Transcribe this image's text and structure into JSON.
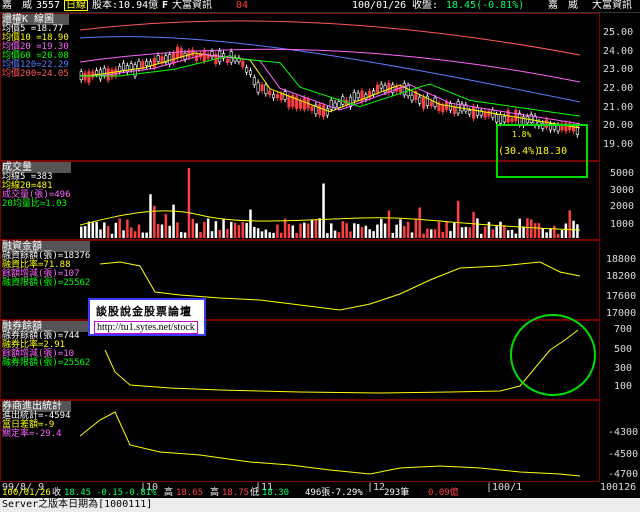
{
  "header": {
    "stock_name": "嘉　威",
    "code": "3557",
    "period": "日線",
    "capital": "股本:10.94億",
    "f_mark": "F",
    "data_source": "大富資訊",
    "counter": "04",
    "date": "100/01/26",
    "close_label": "收盤:",
    "close_value": "18.45(-0.81%)",
    "right_name": "嘉　威",
    "right_source": "大富資訊"
  },
  "price_panel": {
    "title": "還權K 線圖",
    "legend": [
      {
        "label": "均價5 =18.77",
        "color": "#ffffff"
      },
      {
        "label": "均價10 =18.90",
        "color": "#ffff00"
      },
      {
        "label": "均價20 =19.30",
        "color": "#ff66ff"
      },
      {
        "label": "均價60 =20.08",
        "color": "#00ff00"
      },
      {
        "label": "均價120=22.29",
        "color": "#5a7dff"
      },
      {
        "label": "均價200=24.05",
        "color": "#ff5a5a"
      }
    ],
    "ticks": [
      "25.00",
      "24.00",
      "23.00",
      "22.00",
      "21.00",
      "20.00",
      "19.00"
    ],
    "annotation_pct": "(30.4%)",
    "annotation_price": "18.30",
    "annotation_mid": "1.8%"
  },
  "volume_panel": {
    "title": "成交量",
    "legend": [
      {
        "label": "均線5 =383",
        "color": "#ffffff"
      },
      {
        "label": "均線20=481",
        "color": "#ffff00"
      },
      {
        "label": "成交量(張)=496",
        "color": "#ff66ff"
      },
      {
        "label": "20均量比=1.03",
        "color": "#00ff00"
      }
    ],
    "ticks": [
      "5000",
      "3000",
      "2000",
      "1000"
    ]
  },
  "margin_panel": {
    "title": "融資金額",
    "legend": [
      {
        "label": "融資餘額(張)=18376",
        "color": "#ffffff"
      },
      {
        "label": "融資比率=71.88",
        "color": "#ffff00"
      },
      {
        "label": "餘額增減(張)=107",
        "color": "#ff66ff"
      },
      {
        "label": "融資限額(張)=25562",
        "color": "#00ff00"
      }
    ],
    "ticks": [
      "18800",
      "18200",
      "17600",
      "17000"
    ]
  },
  "short_panel": {
    "title": "融券餘額",
    "legend": [
      {
        "label": "融券餘額(張)=744",
        "color": "#ffffff"
      },
      {
        "label": "融券比率=2.91",
        "color": "#ffff00"
      },
      {
        "label": "餘額增減(張)=10",
        "color": "#ff66ff"
      },
      {
        "label": "融券限額(張)=25562",
        "color": "#00ff00"
      }
    ],
    "ticks": [
      "700",
      "500",
      "300",
      "100"
    ]
  },
  "flow_panel": {
    "title": "券商進出統計",
    "legend": [
      {
        "label": "進出統計=-4594",
        "color": "#ffffff"
      },
      {
        "label": "當日差額=-9",
        "color": "#ffff00"
      },
      {
        "label": "關定率=-29.4",
        "color": "#ff66ff"
      }
    ],
    "ticks": [
      "-4300",
      "-4500",
      "-4700"
    ]
  },
  "x_axis": {
    "labels": [
      "99/8/ 9",
      "|10",
      "|11",
      "|12",
      "|100/1",
      "100126"
    ]
  },
  "info_bar": {
    "date": "100/01/26",
    "close_label": "收",
    "close": "18.45",
    "change": "-0.15",
    "pct": "-0.81%",
    "high_label": "高",
    "high": "18.65",
    "open_label": "高",
    "open": "18.75",
    "low_label": "低",
    "low": "18.30",
    "volume": "496張-7.29%",
    "lots": "293筆",
    "turnover": "0.09億"
  },
  "status": {
    "text": "Server之版本日期為[1000111]"
  },
  "forum": {
    "title": "談股說金股票論壇",
    "url": "http://tu1.sytes.net/stock"
  }
}
